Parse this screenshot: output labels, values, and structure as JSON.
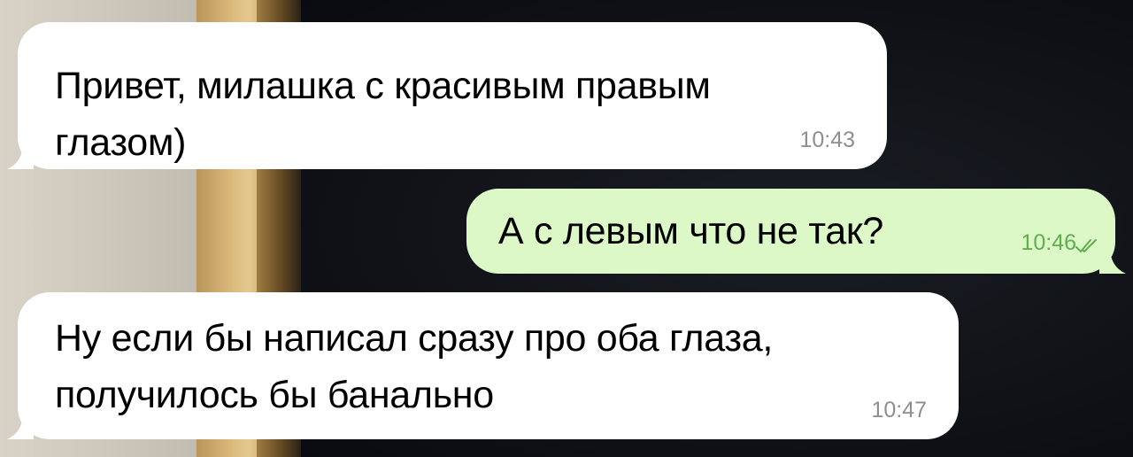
{
  "messages": [
    {
      "direction": "incoming",
      "lines": [
        "Привет, милашка с красивым правым",
        "глазом)"
      ],
      "time": "10:43"
    },
    {
      "direction": "outgoing",
      "lines": [
        "А с левым что не так?"
      ],
      "time": "10:46",
      "status_icon": "double-check-icon"
    },
    {
      "direction": "incoming",
      "lines": [
        "Ну если бы написал сразу про оба глаза,",
        "получилось бы банально"
      ],
      "time": "10:47"
    }
  ],
  "colors": {
    "incoming_bubble": "#ffffff",
    "outgoing_bubble": "#dcf8c6",
    "timestamp": "#8e8e93",
    "read_check": "#5fae4f"
  }
}
